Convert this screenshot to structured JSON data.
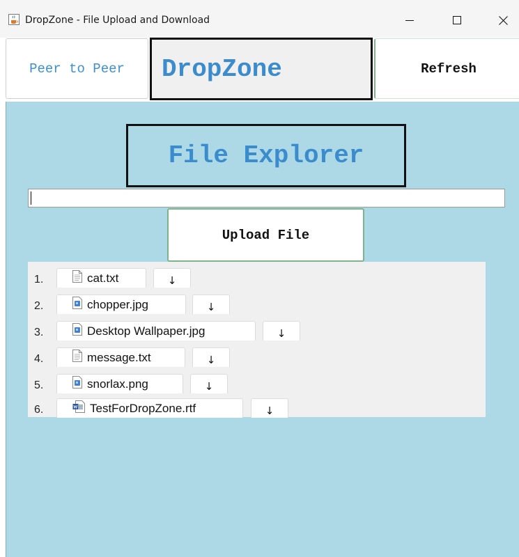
{
  "window": {
    "title": "DropZone - File Upload and Download",
    "icon": "java-cup-icon"
  },
  "header": {
    "peer_label": "Peer to Peer",
    "brand": "DropZone",
    "refresh_label": "Refresh"
  },
  "explorer": {
    "title": "File Explorer",
    "path_value": "",
    "upload_label": "Upload File",
    "download_glyph": "↓",
    "files": [
      {
        "num": "1.",
        "name": "cat.txt",
        "icon": "text-file-icon"
      },
      {
        "num": "2.",
        "name": "chopper.jpg",
        "icon": "image-file-icon"
      },
      {
        "num": "3.",
        "name": "Desktop Wallpaper.jpg",
        "icon": "image-file-icon"
      },
      {
        "num": "4.",
        "name": "message.txt",
        "icon": "text-file-icon"
      },
      {
        "num": "5.",
        "name": "snorlax.png",
        "icon": "image-file-icon"
      },
      {
        "num": "6.",
        "name": "TestForDropZone.rtf",
        "icon": "word-file-icon"
      }
    ]
  },
  "colors": {
    "panel_bg": "#add8e6",
    "accent_text": "#3a8ccd",
    "list_bg": "#f0f0f0"
  }
}
